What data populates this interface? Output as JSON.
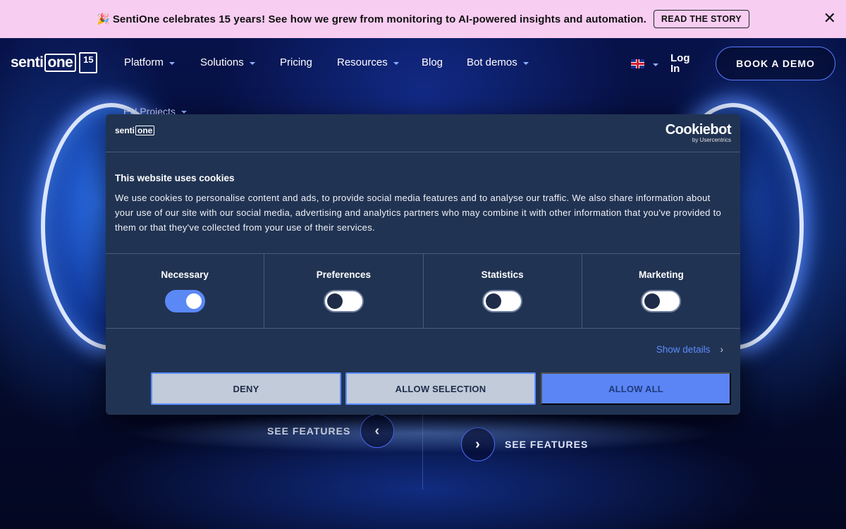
{
  "announcement": {
    "emoji": "🎉",
    "text": "SentiOne celebrates 15 years! See how we grew from monitoring to AI-powered insights and automation.",
    "cta": "READ THE STORY",
    "close": "✕"
  },
  "logo": {
    "part1": "senti",
    "part2": "one",
    "years": "15"
  },
  "nav": {
    "items": [
      {
        "label": "Platform",
        "dropdown": true
      },
      {
        "label": "Solutions",
        "dropdown": true
      },
      {
        "label": "Pricing",
        "dropdown": false
      },
      {
        "label": "Resources",
        "dropdown": true
      },
      {
        "label": "Blog",
        "dropdown": false
      },
      {
        "label": "Bot demos",
        "dropdown": true
      }
    ],
    "extra_item": "EU Projects",
    "login": "Log In",
    "book_demo": "BOOK A DEMO"
  },
  "hero": {
    "see_features_left": "SEE FEATURES",
    "see_features_right": "SEE FEATURES",
    "prev_icon": "‹",
    "next_icon": "›"
  },
  "cookie_dialog": {
    "logo_part1": "senti",
    "logo_part2": "one",
    "brand": "Cookiebot",
    "brand_sub": "by Usercentrics",
    "title": "This website uses cookies",
    "body": "We use cookies to personalise content and ads, to provide social media features and to analyse our traffic. We also share information about your use of our site with our social media, advertising and analytics partners who may combine it with other information that you've provided to them or that they've collected from your use of their services.",
    "categories": [
      {
        "label": "Necessary",
        "enabled": true
      },
      {
        "label": "Preferences",
        "enabled": false
      },
      {
        "label": "Statistics",
        "enabled": false
      },
      {
        "label": "Marketing",
        "enabled": false
      }
    ],
    "show_details": "Show details",
    "buttons": {
      "deny": "DENY",
      "allow_selection": "ALLOW SELECTION",
      "allow_all": "ALLOW ALL"
    }
  },
  "colors": {
    "accent": "#5b8cff",
    "dialog_bg": "#213352",
    "announce_bg": "#f8cdf2"
  }
}
